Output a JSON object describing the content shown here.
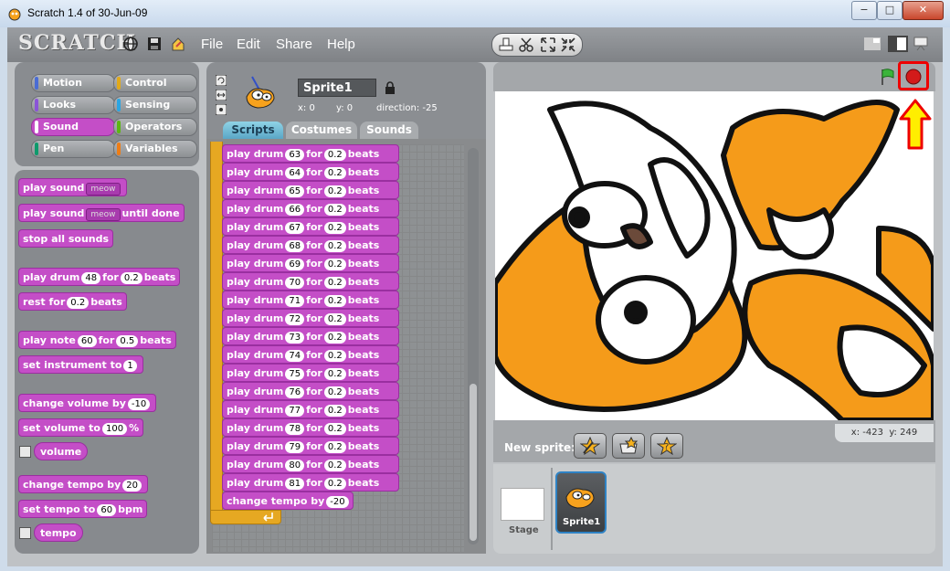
{
  "window": {
    "title": "Scratch 1.4 of 30-Jun-09",
    "minimize": "−",
    "maximize": "□",
    "close": "✕"
  },
  "menu": {
    "logo": "SCRATCH",
    "items": [
      "File",
      "Edit",
      "Share",
      "Help"
    ]
  },
  "categories": [
    {
      "label": "Motion",
      "color": "#4a6cd4"
    },
    {
      "label": "Control",
      "color": "#e1a91a"
    },
    {
      "label": "Looks",
      "color": "#8a55d7"
    },
    {
      "label": "Sensing",
      "color": "#2ca5e2"
    },
    {
      "label": "Sound",
      "color": "#bb42c3"
    },
    {
      "label": "Operators",
      "color": "#5cb712"
    },
    {
      "label": "Pen",
      "color": "#0e9a6c"
    },
    {
      "label": "Variables",
      "color": "#ee7d16"
    }
  ],
  "palette": {
    "play_sound": "play sound",
    "meow": "meow",
    "play_sound_until_done_pre": "play sound",
    "until_done": "until done",
    "stop_all_sounds": "stop all sounds",
    "play_drum": "play drum",
    "drum_num": "48",
    "for": "for",
    "beats_val": "0.2",
    "beats": "beats",
    "rest_for": "rest for",
    "rest_val": "0.2",
    "play_note": "play note",
    "note_val": "60",
    "note_beats": "0.5",
    "set_instrument": "set instrument to",
    "instrument_val": "1",
    "change_volume": "change volume by",
    "change_volume_val": "-10",
    "set_volume": "set volume to",
    "set_volume_val": "100",
    "percent": "%",
    "volume": "volume",
    "change_tempo": "change tempo by",
    "change_tempo_val": "20",
    "set_tempo": "set tempo to",
    "set_tempo_val": "60",
    "bpm": "bpm",
    "tempo": "tempo"
  },
  "sprite": {
    "name": "Sprite1",
    "x_label": "x:",
    "x": "0",
    "y_label": "y:",
    "y": "0",
    "direction_label": "direction:",
    "direction": "-25"
  },
  "tabs": [
    "Scripts",
    "Costumes",
    "Sounds"
  ],
  "script": {
    "drums": [
      "63",
      "64",
      "65",
      "66",
      "67",
      "68",
      "69",
      "70",
      "71",
      "72",
      "73",
      "74",
      "75",
      "76",
      "77",
      "78",
      "79",
      "80",
      "81"
    ],
    "drum_label": "play drum",
    "for": "for",
    "beats_val": "0.2",
    "beats": "beats",
    "last_block": "change tempo by",
    "last_val": "-20"
  },
  "stage": {
    "coords_x_label": "x:",
    "coords_x": "-423",
    "coords_y_label": "y:",
    "coords_y": "249"
  },
  "new_sprite_label": "New sprite:",
  "sprites": {
    "stage_label": "Stage",
    "sprite_label": "Sprite1"
  },
  "colors": {
    "sound": "#c44ec7",
    "control": "#e6a822",
    "highlight": "#ff0000",
    "arrow": "#ffee00"
  }
}
